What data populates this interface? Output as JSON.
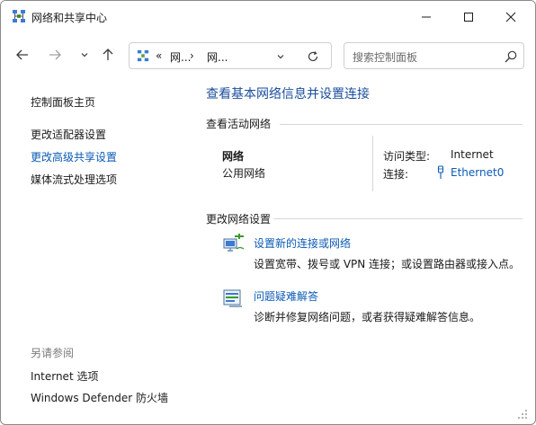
{
  "window": {
    "title": "网络和共享中心",
    "controls": {
      "minimize": "minimize",
      "maximize": "maximize",
      "close": "close"
    }
  },
  "navbar": {
    "address": {
      "chevrons": "«",
      "segment1": "网...",
      "separator": "›",
      "segment2": "网..."
    },
    "search": {
      "placeholder": "搜索控制面板"
    }
  },
  "sidebar": {
    "home": "控制面板主页",
    "items": [
      "更改适配器设置",
      "更改高级共享设置",
      "媒体流式处理选项"
    ],
    "see_also_heading": "另请参阅",
    "see_also": [
      "Internet 选项",
      "Windows Defender 防火墙"
    ]
  },
  "main": {
    "title": "查看基本网络信息并设置连接",
    "active_networks": {
      "heading": "查看活动网络",
      "network_name": "网络",
      "network_type": "公用网络",
      "access_type_label": "访问类型:",
      "access_type_value": "Internet",
      "connection_label": "连接:",
      "connection_value": "Ethernet0"
    },
    "change_settings": {
      "heading": "更改网络设置",
      "tasks": [
        {
          "link": "设置新的连接或网络",
          "description": "设置宽带、拨号或 VPN 连接；或设置路由器或接入点。"
        },
        {
          "link": "问题疑难解答",
          "description": "诊断并修复网络问题，或者获得疑难解答信息。"
        }
      ]
    }
  },
  "colors": {
    "link": "#0b5bb5",
    "title": "#1a4e9c",
    "text": "#1a1a1a",
    "muted": "#7a7a7a"
  }
}
